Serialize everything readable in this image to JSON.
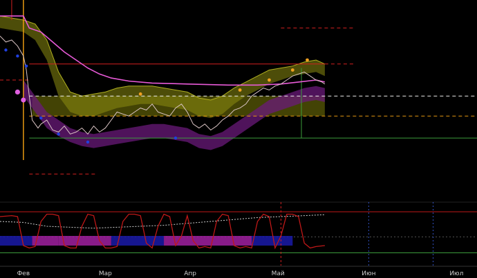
{
  "chart_data": {
    "type": "line",
    "title": "",
    "xlabel": "",
    "ylabel": "",
    "x_tick_labels": [
      "Фев",
      "Мар",
      "Апр",
      "Май",
      "Июн",
      "Июл"
    ],
    "x_tick_days": [
      0,
      28,
      57,
      87,
      118,
      148
    ],
    "x_range_days": [
      -8,
      155
    ],
    "y_range": [
      0,
      100
    ],
    "grid": false,
    "legend": "none",
    "colors": {
      "background": "#000000",
      "price": "#d9c3c3",
      "cloud_upper": "#8c8c10",
      "cloud_lower": "#6a1a7a",
      "trail": "#e85ad8",
      "level_red": "#d42020",
      "level_orange": "#e89a10",
      "level_white": "#f0f0f0",
      "level_green": "#3c9c3c",
      "osc_red": "#c01818",
      "osc_magenta": "#a020a0",
      "osc_blue": "#1a1aa8",
      "vline_blue": "#3050c0"
    },
    "price_series": {
      "name": "",
      "points": [
        [
          -8,
          82
        ],
        [
          -6,
          79
        ],
        [
          -4,
          80
        ],
        [
          -2,
          77
        ],
        [
          0,
          72
        ],
        [
          1,
          65
        ],
        [
          2,
          52
        ],
        [
          3,
          40
        ],
        [
          4,
          38
        ],
        [
          5,
          36
        ],
        [
          6,
          38
        ],
        [
          8,
          40
        ],
        [
          10,
          35
        ],
        [
          12,
          34
        ],
        [
          14,
          37
        ],
        [
          16,
          33
        ],
        [
          18,
          34
        ],
        [
          20,
          36
        ],
        [
          22,
          33
        ],
        [
          24,
          37
        ],
        [
          26,
          34
        ],
        [
          28,
          36
        ],
        [
          30,
          40
        ],
        [
          32,
          44
        ],
        [
          34,
          43
        ],
        [
          36,
          42
        ],
        [
          38,
          44
        ],
        [
          40,
          46
        ],
        [
          42,
          45
        ],
        [
          44,
          48
        ],
        [
          46,
          44
        ],
        [
          48,
          43
        ],
        [
          50,
          42
        ],
        [
          52,
          46
        ],
        [
          54,
          48
        ],
        [
          56,
          44
        ],
        [
          58,
          38
        ],
        [
          60,
          36
        ],
        [
          62,
          38
        ],
        [
          64,
          35
        ],
        [
          66,
          37
        ],
        [
          68,
          40
        ],
        [
          70,
          42
        ],
        [
          72,
          45
        ],
        [
          74,
          46
        ],
        [
          76,
          48
        ],
        [
          78,
          52
        ],
        [
          80,
          54
        ],
        [
          82,
          56
        ],
        [
          84,
          55
        ],
        [
          86,
          57
        ],
        [
          88,
          58
        ],
        [
          90,
          60
        ],
        [
          92,
          62
        ],
        [
          94,
          63
        ],
        [
          96,
          64
        ],
        [
          98,
          62
        ],
        [
          100,
          60
        ],
        [
          102,
          59
        ],
        [
          103,
          58
        ]
      ]
    },
    "trail_series": {
      "name": "",
      "points": [
        [
          -8,
          92
        ],
        [
          0,
          92
        ],
        [
          2,
          86
        ],
        [
          6,
          84
        ],
        [
          10,
          79
        ],
        [
          14,
          74
        ],
        [
          18,
          70
        ],
        [
          22,
          66
        ],
        [
          26,
          63
        ],
        [
          30,
          61
        ],
        [
          36,
          59.5
        ],
        [
          44,
          58.5
        ],
        [
          56,
          58
        ],
        [
          70,
          57.5
        ],
        [
          80,
          57.5
        ],
        [
          88,
          58
        ],
        [
          94,
          59
        ],
        [
          100,
          60
        ],
        [
          103,
          59
        ]
      ]
    },
    "cloud_band": {
      "name": "",
      "upper": [
        [
          -8,
          92
        ],
        [
          0,
          90
        ],
        [
          4,
          88
        ],
        [
          8,
          80
        ],
        [
          12,
          64
        ],
        [
          16,
          54
        ],
        [
          20,
          52
        ],
        [
          24,
          53
        ],
        [
          28,
          54
        ],
        [
          32,
          56
        ],
        [
          36,
          57
        ],
        [
          40,
          57
        ],
        [
          44,
          57
        ],
        [
          48,
          56
        ],
        [
          52,
          55
        ],
        [
          56,
          54
        ],
        [
          60,
          51
        ],
        [
          64,
          50
        ],
        [
          68,
          52
        ],
        [
          72,
          56
        ],
        [
          76,
          59
        ],
        [
          80,
          62
        ],
        [
          84,
          65
        ],
        [
          88,
          66
        ],
        [
          92,
          67
        ],
        [
          96,
          69
        ],
        [
          100,
          70
        ],
        [
          103,
          68
        ]
      ],
      "lower": [
        [
          -8,
          86
        ],
        [
          0,
          84
        ],
        [
          4,
          80
        ],
        [
          8,
          70
        ],
        [
          12,
          52
        ],
        [
          16,
          44
        ],
        [
          20,
          42
        ],
        [
          24,
          42
        ],
        [
          28,
          44
        ],
        [
          32,
          46
        ],
        [
          36,
          47
        ],
        [
          40,
          48
        ],
        [
          44,
          48
        ],
        [
          48,
          47
        ],
        [
          52,
          46
        ],
        [
          56,
          45
        ],
        [
          60,
          42
        ],
        [
          64,
          41
        ],
        [
          68,
          43
        ],
        [
          72,
          48
        ],
        [
          76,
          52
        ],
        [
          80,
          55
        ],
        [
          84,
          58
        ],
        [
          88,
          60
        ],
        [
          92,
          62
        ],
        [
          96,
          63
        ],
        [
          100,
          64
        ],
        [
          103,
          62
        ]
      ]
    },
    "lower_band": {
      "name": "",
      "upper": [
        [
          0,
          60
        ],
        [
          4,
          52
        ],
        [
          8,
          44
        ],
        [
          12,
          40
        ],
        [
          16,
          36
        ],
        [
          20,
          34
        ],
        [
          24,
          33
        ],
        [
          28,
          34
        ],
        [
          32,
          35
        ],
        [
          36,
          36
        ],
        [
          40,
          37
        ],
        [
          44,
          38
        ],
        [
          48,
          38
        ],
        [
          52,
          37
        ],
        [
          56,
          36
        ],
        [
          60,
          33
        ],
        [
          64,
          32
        ],
        [
          68,
          34
        ],
        [
          72,
          38
        ],
        [
          76,
          42
        ],
        [
          80,
          46
        ],
        [
          84,
          50
        ],
        [
          88,
          52
        ],
        [
          92,
          54
        ],
        [
          96,
          56
        ],
        [
          100,
          57
        ],
        [
          103,
          56
        ]
      ],
      "lower": [
        [
          0,
          52
        ],
        [
          4,
          44
        ],
        [
          8,
          36
        ],
        [
          12,
          32
        ],
        [
          16,
          29
        ],
        [
          20,
          27
        ],
        [
          24,
          26
        ],
        [
          28,
          27
        ],
        [
          32,
          28
        ],
        [
          36,
          29
        ],
        [
          40,
          30
        ],
        [
          44,
          31
        ],
        [
          48,
          31
        ],
        [
          52,
          30
        ],
        [
          56,
          29
        ],
        [
          60,
          26
        ],
        [
          64,
          25
        ],
        [
          68,
          27
        ],
        [
          72,
          31
        ],
        [
          76,
          35
        ],
        [
          80,
          39
        ],
        [
          84,
          43
        ],
        [
          88,
          45
        ],
        [
          92,
          47
        ],
        [
          96,
          49
        ],
        [
          100,
          50
        ],
        [
          103,
          49
        ]
      ]
    },
    "levels": [
      {
        "value": 86,
        "x_from": 88,
        "x_to": 113,
        "style": "dash",
        "color": "level_red"
      },
      {
        "value": 68,
        "x_from": 2,
        "x_to": 103,
        "style": "solid",
        "color": "level_red"
      },
      {
        "value": 68,
        "x_from": 103,
        "x_to": 113,
        "style": "dash",
        "color": "level_red"
      },
      {
        "value": 52,
        "x_from": 2,
        "x_to": 155,
        "style": "dash",
        "color": "level_white"
      },
      {
        "value": 42,
        "x_from": 2,
        "x_to": 155,
        "style": "dash",
        "color": "level_orange"
      },
      {
        "value": 31,
        "x_from": 2,
        "x_to": 155,
        "style": "solid",
        "color": "level_green"
      },
      {
        "value": 13,
        "x_from": 2,
        "x_to": 25,
        "style": "dash",
        "color": "level_red"
      },
      {
        "value": 60,
        "x_from": -8,
        "x_to": 2,
        "style": "dash",
        "color": "level_red"
      }
    ],
    "yellow_box": {
      "x_from": 3,
      "x_to": 103,
      "y_low": 42,
      "y_high": 52
    },
    "orange_dots": [
      [
        40,
        53
      ],
      [
        74,
        55
      ],
      [
        84,
        60
      ],
      [
        92,
        65
      ],
      [
        97,
        70
      ]
    ],
    "blue_dots": [
      [
        -6,
        75
      ],
      [
        -2,
        72
      ],
      [
        1,
        67
      ],
      [
        6,
        41
      ],
      [
        12,
        33
      ],
      [
        22,
        29
      ],
      [
        52,
        31
      ]
    ],
    "pink_dots": [
      [
        -2,
        54
      ],
      [
        0,
        50
      ]
    ],
    "osc_line_red": {
      "name": "",
      "points": [
        [
          -8,
          80
        ],
        [
          -4,
          82
        ],
        [
          -2,
          80
        ],
        [
          0,
          20
        ],
        [
          2,
          15
        ],
        [
          4,
          18
        ],
        [
          6,
          70
        ],
        [
          8,
          85
        ],
        [
          10,
          85
        ],
        [
          12,
          82
        ],
        [
          14,
          20
        ],
        [
          16,
          15
        ],
        [
          18,
          15
        ],
        [
          20,
          60
        ],
        [
          22,
          85
        ],
        [
          24,
          82
        ],
        [
          26,
          30
        ],
        [
          28,
          15
        ],
        [
          30,
          15
        ],
        [
          32,
          18
        ],
        [
          34,
          70
        ],
        [
          36,
          85
        ],
        [
          38,
          85
        ],
        [
          40,
          82
        ],
        [
          42,
          25
        ],
        [
          44,
          15
        ],
        [
          46,
          60
        ],
        [
          48,
          85
        ],
        [
          50,
          80
        ],
        [
          52,
          20
        ],
        [
          54,
          40
        ],
        [
          56,
          82
        ],
        [
          58,
          30
        ],
        [
          60,
          15
        ],
        [
          62,
          18
        ],
        [
          64,
          15
        ],
        [
          66,
          70
        ],
        [
          68,
          85
        ],
        [
          70,
          82
        ],
        [
          72,
          20
        ],
        [
          74,
          15
        ],
        [
          76,
          18
        ],
        [
          78,
          15
        ],
        [
          80,
          70
        ],
        [
          82,
          85
        ],
        [
          84,
          80
        ],
        [
          86,
          15
        ],
        [
          88,
          40
        ],
        [
          90,
          85
        ],
        [
          92,
          85
        ],
        [
          94,
          80
        ],
        [
          96,
          25
        ],
        [
          98,
          15
        ],
        [
          100,
          18
        ],
        [
          103,
          20
        ]
      ]
    },
    "osc_line_white": {
      "name": "",
      "points": [
        [
          -8,
          70
        ],
        [
          0,
          68
        ],
        [
          8,
          60
        ],
        [
          16,
          58
        ],
        [
          24,
          56
        ],
        [
          32,
          58
        ],
        [
          40,
          60
        ],
        [
          48,
          62
        ],
        [
          56,
          66
        ],
        [
          64,
          70
        ],
        [
          72,
          74
        ],
        [
          80,
          78
        ],
        [
          88,
          80
        ],
        [
          96,
          82
        ],
        [
          103,
          84
        ]
      ]
    },
    "osc_bars": [
      {
        "x_from": -8,
        "x_to": 3,
        "color": "osc_blue"
      },
      {
        "x_from": 3,
        "x_to": 12,
        "color": "osc_magenta"
      },
      {
        "x_from": 12,
        "x_to": 30,
        "color": "osc_magenta"
      },
      {
        "x_from": 30,
        "x_to": 48,
        "color": "osc_blue"
      },
      {
        "x_from": 48,
        "x_to": 78,
        "color": "osc_magenta"
      },
      {
        "x_from": 78,
        "x_to": 92,
        "color": "osc_blue"
      }
    ],
    "vlines_blue": [
      118,
      140
    ],
    "vline_green": 95,
    "vline_red": 88
  }
}
